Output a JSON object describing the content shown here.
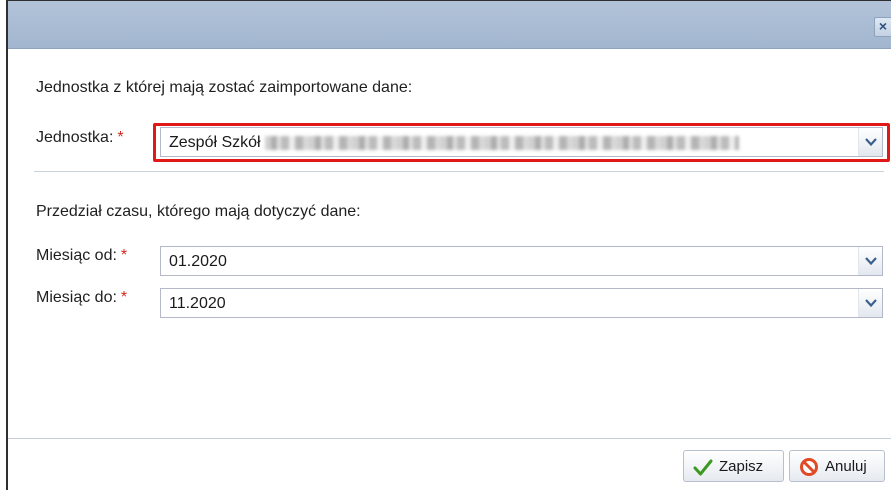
{
  "dialog": {
    "close_label": "×"
  },
  "source_section": {
    "heading": "Jednostka z której mają zostać zaimportowane dane:",
    "unit_label": "Jednostka:",
    "required_mark": "*",
    "unit_value": "Zespół Szkół"
  },
  "period_section": {
    "heading": "Przedział czasu, którego mają dotyczyć dane:",
    "from_label": "Miesiąc od:",
    "from_value": "01.2020",
    "to_label": "Miesiąc do:",
    "to_value": "11.2020",
    "required_mark": "*"
  },
  "footer": {
    "save_label": "Zapisz",
    "cancel_label": "Anuluj"
  },
  "icons": {
    "close": "close-icon",
    "dropdown": "chevron-down-icon",
    "save": "checkmark-icon",
    "cancel": "prohibited-icon"
  },
  "colors": {
    "titlebar": "#a9bcd4",
    "required": "#d7261f",
    "highlight": "#e01818",
    "save_check": "#3a9a1f",
    "cancel_ring": "#e04a24"
  }
}
